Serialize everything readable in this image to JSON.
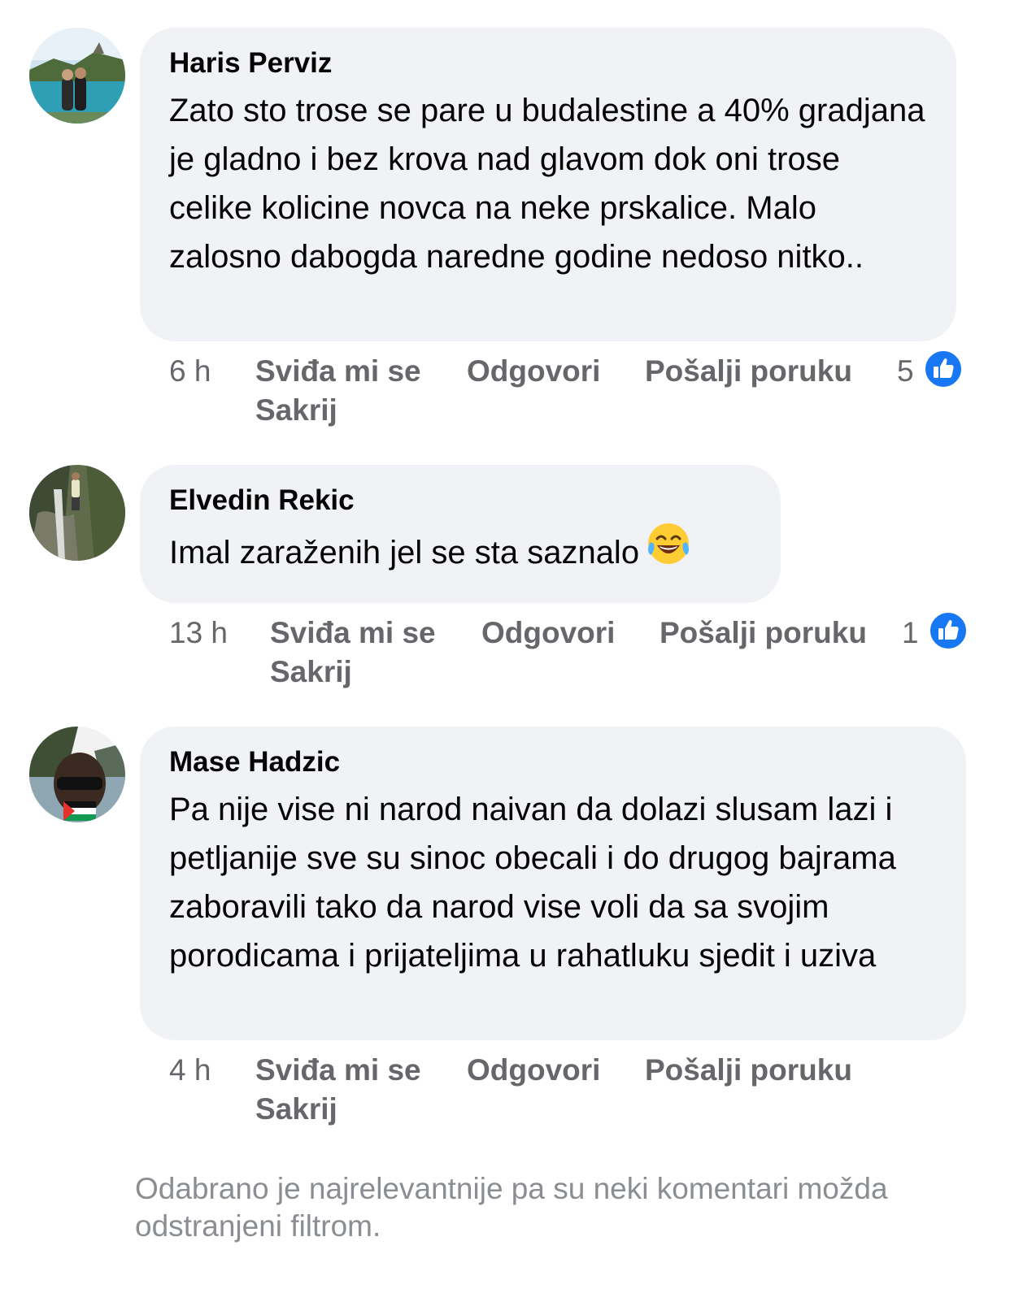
{
  "comments": [
    {
      "author": "Haris Perviz",
      "text": "Zato sto trose se pare u budalestine a 40% gradjana je gladno i bez krova nad glavom dok oni trose celike kolicine novca na neke prskalice. Malo zalosno dabogda naredne godine nedoso nitko..",
      "time": "6 h",
      "like_label": "Sviđa mi se",
      "reply_label": "Odgovori",
      "message_label": "Pošalji poruku",
      "hide_label": "Sakrij",
      "like_count": "5"
    },
    {
      "author": "Elvedin Rekic",
      "text": "Imal zaraženih jel se sta saznalo",
      "emoji": "face-with-tears-of-joy",
      "time": "13 h",
      "like_label": "Sviđa mi se",
      "reply_label": "Odgovori",
      "message_label": "Pošalji poruku",
      "hide_label": "Sakrij",
      "like_count": "1"
    },
    {
      "author": "Mase Hadzic",
      "text": "Pa nije vise ni narod naivan da dolazi slusam lazi i petljanije sve su sinoc obecali i do drugog bajrama zaboravili tako da narod vise voli da sa svojim porodicama i prijateljima u rahatluku sjedit i uziva",
      "time": "4 h",
      "like_label": "Sviđa mi se",
      "reply_label": "Odgovori",
      "message_label": "Pošalji poruku",
      "hide_label": "Sakrij"
    }
  ],
  "footer_note": "Odabrano je najrelevantnije pa su neki komentari možda odstranjeni filtrom.",
  "colors": {
    "bubble": "#f0f2f5",
    "meta_text": "#65676b",
    "like_blue": "#1877f2",
    "footer_text": "#8a8d91"
  },
  "icons": {
    "like": "thumbs-up-icon",
    "emoji": "laughing-emoji-icon"
  }
}
